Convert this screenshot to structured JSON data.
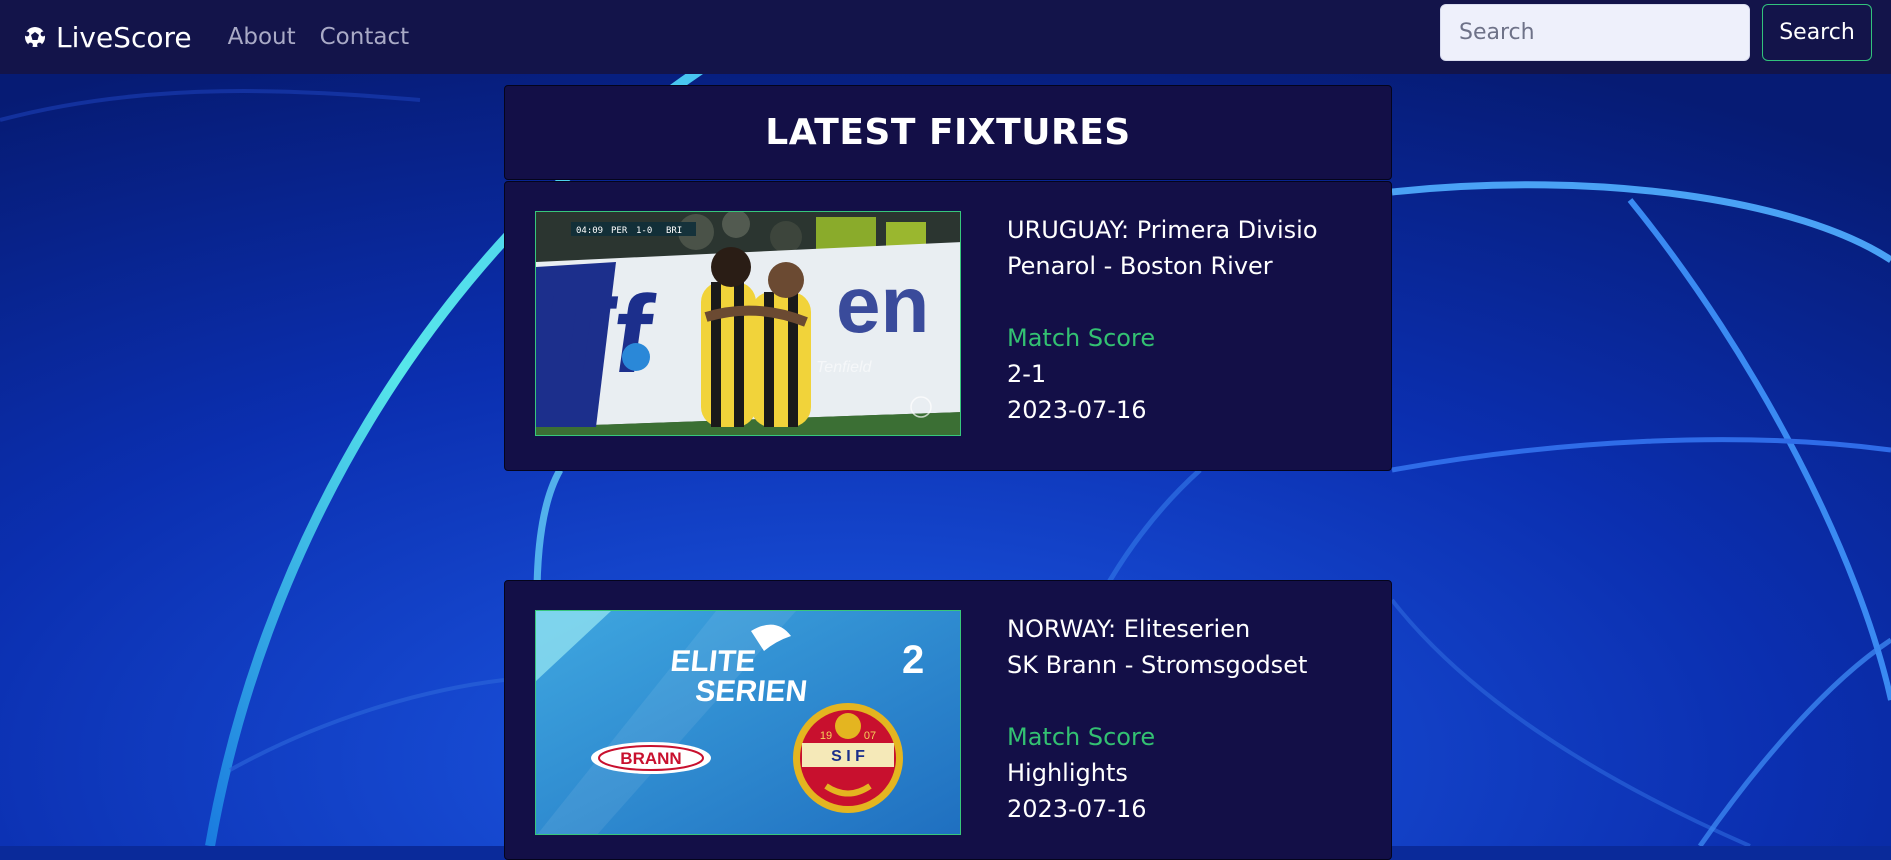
{
  "navbar": {
    "brand": "LiveScore",
    "links": [
      "About",
      "Contact"
    ],
    "search_placeholder": "Search",
    "search_button": "Search"
  },
  "section_title": "LATEST FIXTURES",
  "fixtures": [
    {
      "league": "URUGUAY: Primera Divisio",
      "match": "Penarol - Boston River",
      "score_label": "Match Score",
      "score": "2-1",
      "date": "2023-07-16",
      "thumb": {
        "scoreboard": {
          "time": "04:09",
          "home": "PER",
          "score": "1-0",
          "away": "BRI"
        },
        "ad_text": "Tenfield"
      }
    },
    {
      "league": "NORWAY: Eliteserien",
      "match": "SK Brann - Stromsgodset",
      "score_label": "Match Score",
      "score": "Highlights",
      "date": "2023-07-16",
      "thumb": {
        "logo_line1": "ELITE",
        "logo_line2": "SERIEN",
        "channel": "2",
        "team1_badge": "BRANN",
        "team2_badge_year_left": "19",
        "team2_badge_year_right": "07",
        "team2_badge_initials": "S I F"
      }
    }
  ],
  "colors": {
    "navbar": "#13144a",
    "panel": "#130f47",
    "accent_green": "#33c172",
    "background": "#0a2a9a"
  }
}
